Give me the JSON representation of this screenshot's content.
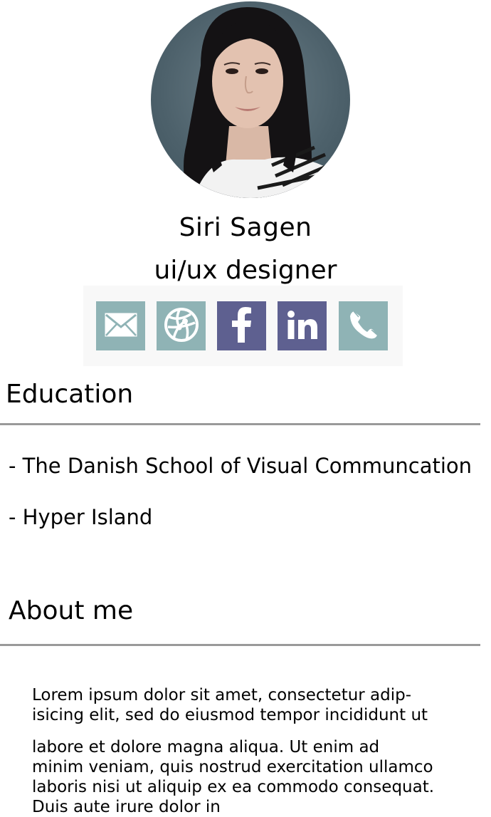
{
  "profile": {
    "name": "Siri Sagen",
    "role": "ui/ux designer"
  },
  "social": [
    {
      "icon": "mail-icon",
      "label": "email",
      "color": "#8fb3b5"
    },
    {
      "icon": "globe-icon",
      "label": "website",
      "color": "#8fb3b5"
    },
    {
      "icon": "facebook-icon",
      "label": "facebook",
      "color": "#5e6090"
    },
    {
      "icon": "linkedin-icon",
      "label": "linkedin",
      "color": "#5e6090"
    },
    {
      "icon": "phone-icon",
      "label": "phone",
      "color": "#8fb3b5"
    }
  ],
  "education": {
    "title": "Education",
    "items": [
      "- The Danish School of Visual Communcation",
      "- Hyper Island"
    ]
  },
  "about": {
    "title": "About me",
    "paragraph1": [
      "Lorem ipsum dolor sit amet, consectetur adip-",
      "isicing elit, sed do eiusmod tempor incididunt ut"
    ],
    "paragraph2": [
      "labore et dolore magna aliqua.  Ut enim ad",
      "minim veniam, quis nostrud exercitation ullamco",
      "laboris nisi ut aliquip ex ea commodo consequat.",
      "Duis aute irure dolor in"
    ]
  },
  "colors": {
    "teal": "#8fb3b5",
    "purple": "#5e6090",
    "rule": "#9a9a9a",
    "social_bg": "#f8f8f8"
  }
}
